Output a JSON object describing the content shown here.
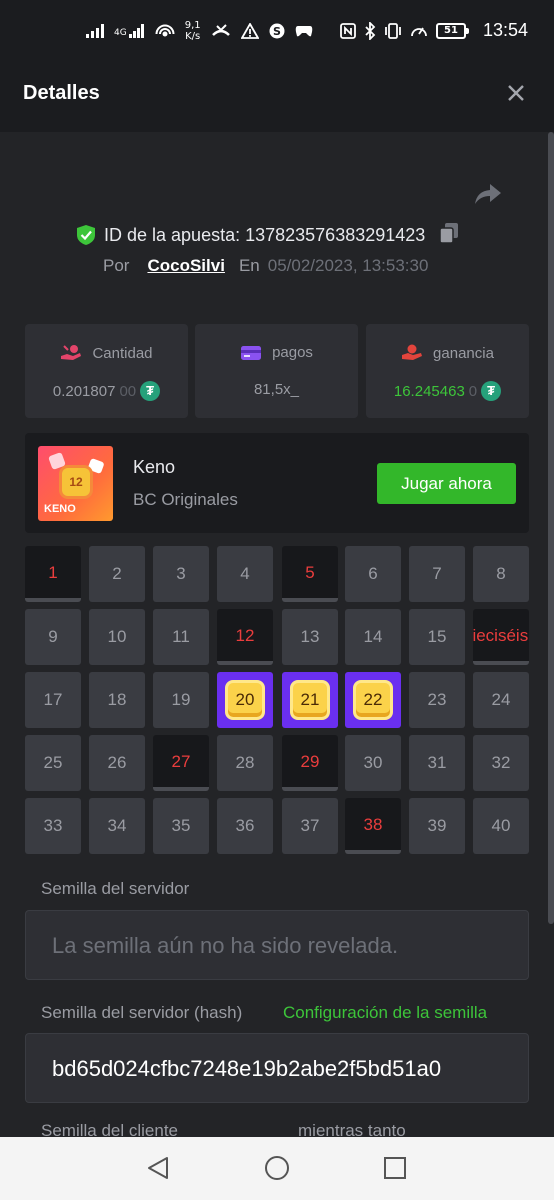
{
  "status_bar": {
    "net_speed_value": "9,1",
    "net_speed_unit": "K/s",
    "signal_label": "4G",
    "battery": "51",
    "time": "13:54"
  },
  "header": {
    "title": "Detalles",
    "close_icon": "close-icon"
  },
  "bet": {
    "id_label": "ID de la apuesta: 137823576383291423",
    "by_label": "Por",
    "user": "CocoSilvi",
    "on_label": "En",
    "date": "05/02/2023, 13:53:30"
  },
  "stats": [
    {
      "label": "Cantidad",
      "value": "0.201807",
      "value_dim": "00",
      "icon": "money-hand-icon",
      "icon_color": "#e3446a"
    },
    {
      "label": "pagos",
      "value": "81,5x_",
      "value_dim": "",
      "icon": "wallet-icon",
      "icon_color": "#8a52f0"
    },
    {
      "label": "ganancia",
      "value": "16.245463",
      "value_dim": "0",
      "icon": "hand-coin-icon",
      "icon_color": "#e3443c"
    }
  ],
  "game": {
    "name": "Keno",
    "provider": "BC Originales",
    "play_label": "Jugar ahora",
    "thumb_number": "12",
    "thumb_text": "KENO"
  },
  "grid": [
    "1",
    "2",
    "3",
    "4",
    "5",
    "6",
    "7",
    "8",
    "9",
    "10",
    "11",
    "12",
    "13",
    "14",
    "15",
    "dieciséis",
    "17",
    "18",
    "19",
    "20",
    "21",
    "22",
    "23",
    "24",
    "25",
    "26",
    "27",
    "28",
    "29",
    "30",
    "31",
    "32",
    "33",
    "34",
    "35",
    "36",
    "37",
    "38",
    "39",
    "40"
  ],
  "seeds": {
    "server_label": "Semilla del servidor",
    "server_placeholder": "La semilla aún no ha sido revelada.",
    "hash_label": "Semilla del servidor (hash)",
    "config_link": "Configuración de la semilla",
    "hash_value": "bd65d024cfbc7248e19b2abe2f5bd51a0",
    "client_label": "Semilla del cliente",
    "nonce_label": "mientras tanto"
  },
  "colors": {
    "accent_green": "#33b72a",
    "picked_red": "#ea3d3d",
    "hit_purple": "#6a2ff0"
  }
}
